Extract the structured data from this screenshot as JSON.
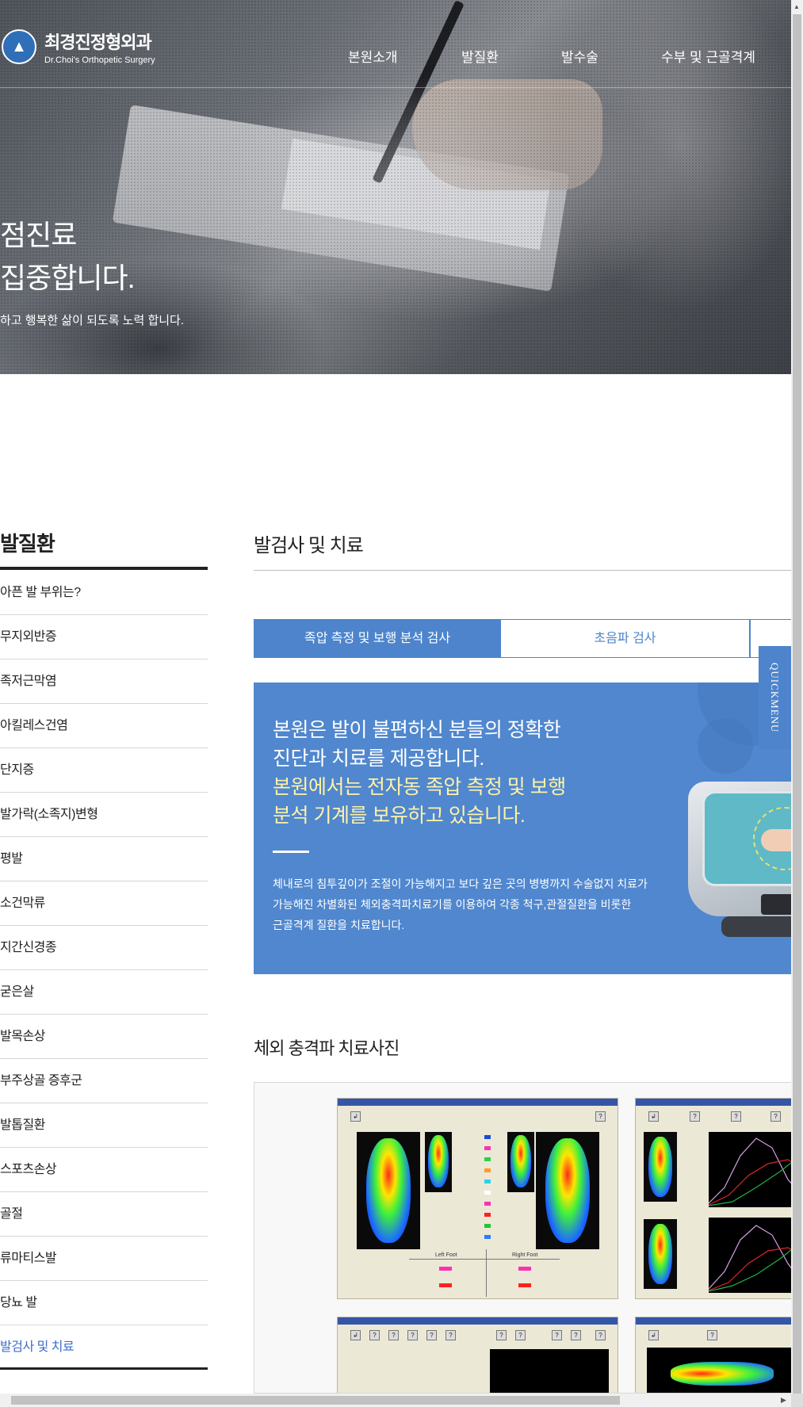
{
  "header": {
    "logo_ko": "최경진정형외과",
    "logo_en": "Dr.Choi's Orthopetic Surgery",
    "nav": [
      "본원소개",
      "발질환",
      "발수술",
      "수부 및 근골격계"
    ]
  },
  "hero": {
    "title_line1": "점진료",
    "title_line2": "집중합니다.",
    "subtitle": "하고 행복한 삶이 되도록 노력 합니다."
  },
  "sidebar": {
    "title": "발질환",
    "items": [
      "아픈 발 부위는?",
      "무지외반증",
      "족저근막염",
      "아킬레스건염",
      "단지증",
      "발가락(소족지)변형",
      "평발",
      "소건막류",
      "지간신경종",
      "굳은살",
      "발목손상",
      "부주상골 증후군",
      "발톱질환",
      "스포츠손상",
      "골절",
      "류마티스발",
      "당뇨 발",
      "발검사 및 치료"
    ],
    "active_index": 17
  },
  "main": {
    "title": "발검사 및 치료",
    "tabs": [
      "족압 측정 및 보행 분석 검사",
      "초음파 검사",
      ""
    ],
    "banner": {
      "head_line1": "본원은 발이 불편하신 분들의 정확한",
      "head_line2": "진단과 치료를 제공합니다.",
      "head_line3": "본원에서는 전자동 족압 측정 및 보행",
      "head_line4": "분석 기계를 보유하고 있습니다.",
      "body_line1": "체내로의 침투깊이가 조절이 가능해지고 보다 깊은 곳의 병병까지 수술없지 치료가",
      "body_line2": "가능해진 차별화된 체외충격파치료기를 이용하여 각종 척구,관절질환을 비롯한",
      "body_line3": "근골격계 질환을 치료합니다."
    },
    "quick_menu": "QUICKMENU",
    "gallery_title": "체외 충격파 치료사진",
    "gallery_labels": {
      "left_foot": "Left Foot",
      "right_foot": "Right Foot"
    }
  },
  "colors": {
    "accent": "#4d84cc",
    "banner": "#5087ce",
    "highlight": "#fff2a8",
    "active_text": "#3d6fc8"
  }
}
